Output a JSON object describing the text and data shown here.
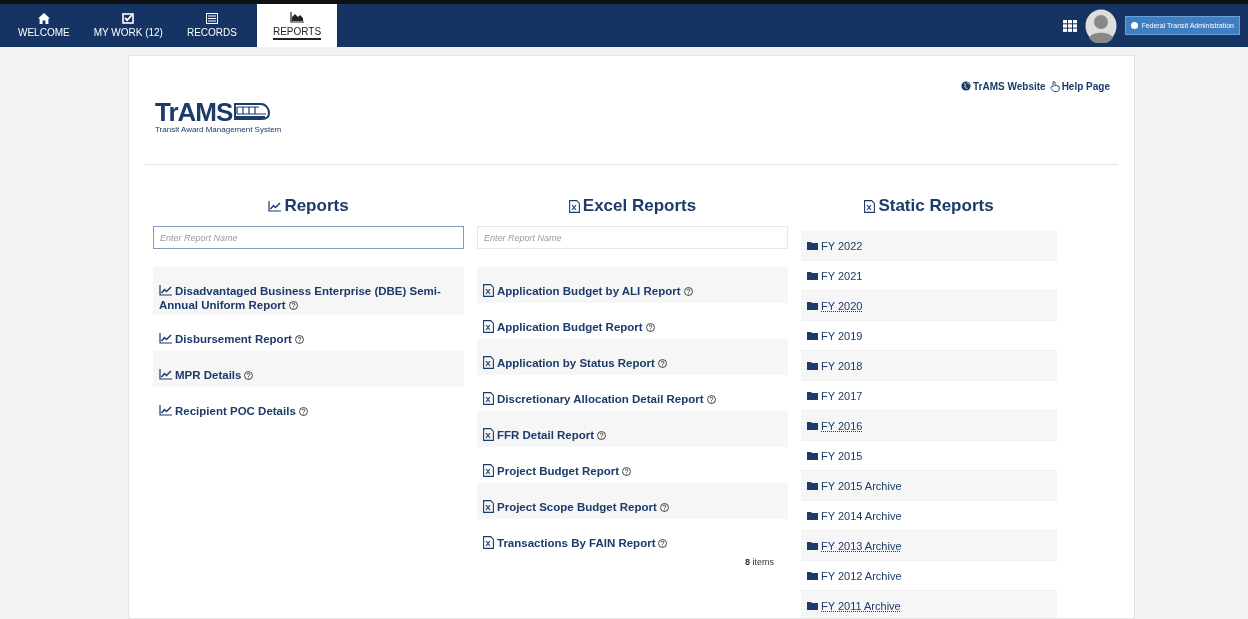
{
  "nav": {
    "tabs": [
      {
        "label": "WELCOME",
        "selected": false
      },
      {
        "label": "MY WORK (12)",
        "selected": false
      },
      {
        "label": "RECORDS",
        "selected": false
      },
      {
        "label": "REPORTS",
        "selected": true
      }
    ],
    "agency_button": "Federal Transit Administration"
  },
  "header": {
    "logo_text": "TrAMS",
    "logo_subtitle": "Transit Award Management System",
    "links": [
      "TrAMS Website",
      "Help Page"
    ]
  },
  "reports": {
    "title": "Reports",
    "search": {
      "placeholder": "Enter Report Name",
      "focused": true
    },
    "items": [
      "Disadvantaged Business Enterprise (DBE) Semi-Annual Uniform Report",
      "Disbursement Report",
      "MPR Details",
      "Recipient POC Details"
    ]
  },
  "excel_reports": {
    "title": "Excel Reports",
    "search": {
      "placeholder": "Enter Report Name",
      "focused": false
    },
    "items": [
      "Application Budget by ALI Report",
      "Application Budget Report",
      "Application by Status Report",
      "Discretionary Allocation Detail Report",
      "FFR Detail Report",
      "Project Budget Report",
      "Project Scope Budget Report",
      "Transactions By FAIN Report"
    ],
    "count": "8",
    "count_label": "items"
  },
  "static_reports": {
    "title": "Static Reports",
    "folders": [
      {
        "label": "FY 2022",
        "underlined": false
      },
      {
        "label": "FY 2021",
        "underlined": false
      },
      {
        "label": "FY 2020",
        "underlined": true
      },
      {
        "label": "FY 2019",
        "underlined": false
      },
      {
        "label": "FY 2018",
        "underlined": false
      },
      {
        "label": "FY 2017",
        "underlined": false
      },
      {
        "label": "FY 2016",
        "underlined": true
      },
      {
        "label": "FY 2015",
        "underlined": false
      },
      {
        "label": "FY 2015 Archive",
        "underlined": false
      },
      {
        "label": "FY 2014 Archive",
        "underlined": false
      },
      {
        "label": "FY 2013 Archive",
        "underlined": true
      },
      {
        "label": "FY 2012 Archive",
        "underlined": false
      },
      {
        "label": "FY 2011 Archive",
        "underlined": true
      }
    ]
  }
}
